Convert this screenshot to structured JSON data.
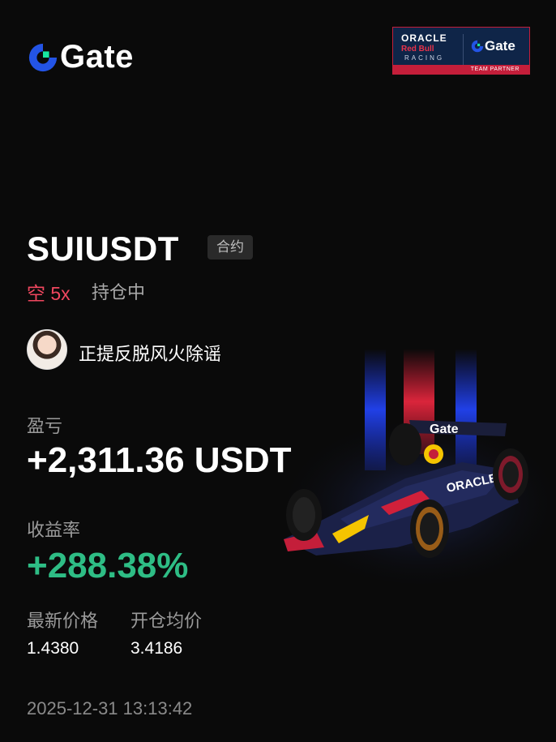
{
  "header": {
    "brand": "Gate",
    "partner": {
      "line1": "ORACLE",
      "line2": "Red Bull",
      "line3": "RACING",
      "brand": "Gate",
      "caption": "TEAM PARTNER"
    }
  },
  "position": {
    "pair": "SUIUSDT",
    "type_badge": "合约",
    "direction": "空 5x",
    "status": "持仓中"
  },
  "user": {
    "name": "正提反脱风火除谣"
  },
  "stats": {
    "pnl_label": "盈亏",
    "pnl_value": "+2,311.36 USDT",
    "roi_label": "收益率",
    "roi_value": "+288.38%",
    "last_price_label": "最新价格",
    "last_price": "1.4380",
    "entry_price_label": "开仓均价",
    "entry_price": "3.4186"
  },
  "timestamp": "2025-12-31 13:13:42",
  "colors": {
    "background": "#0a0a0a",
    "short": "#f0475f",
    "profit": "#2ebd85",
    "gate_blue": "#2354e6",
    "gate_green": "#17e6a1"
  },
  "car": {
    "livery_text": "Gate",
    "sponsor_text": "ORACLE"
  }
}
